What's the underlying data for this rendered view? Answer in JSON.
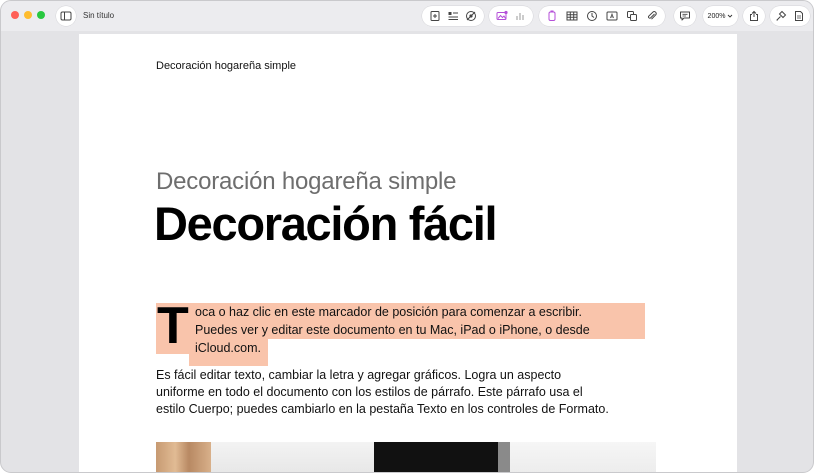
{
  "window": {
    "title": "Sin título"
  },
  "toolbar": {
    "zoom": "200%"
  },
  "document": {
    "header": "Decoración hogareña simple",
    "subtitle": "Decoración hogareña simple",
    "title": "Decoración fácil",
    "dropcap": "T",
    "placeholder_lines": [
      "oca o haz clic en este marcador de posición para comenzar a escribir.",
      "Puedes ver y editar este documento en tu Mac, iPad o iPhone, o desde",
      "iCloud.com."
    ],
    "body_lines": [
      "Es fácil editar texto, cambiar la letra y agregar gráficos. Logra un aspecto",
      "uniforme en todo el documento con los estilos de párrafo. Este párrafo usa el",
      "estilo Cuerpo; puedes cambiarlo en la pestaña Texto en los controles de Formato."
    ]
  },
  "colors": {
    "highlight": "#f9c4ab",
    "accent_purple": "#b44fd8"
  },
  "icons": [
    "sidebar-icon",
    "add-page-icon",
    "text-style-icon",
    "settings-badge-icon",
    "media-icon",
    "chart-icon",
    "shape-icon",
    "table-icon",
    "clock-icon",
    "text-box-icon",
    "copy-icon",
    "paperclip-icon",
    "comment-icon",
    "chevron-down-icon",
    "share-icon",
    "format-brush-icon",
    "document-icon"
  ]
}
